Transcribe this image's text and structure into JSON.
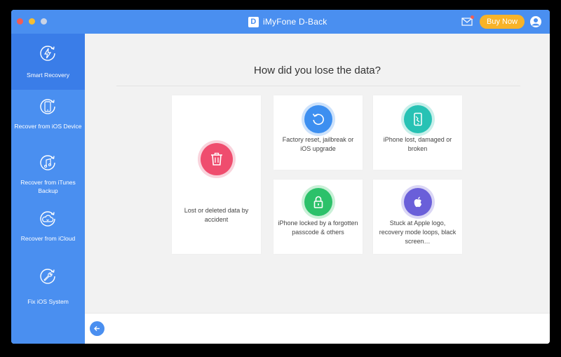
{
  "window": {
    "title": "iMyFone D-Back",
    "logo_letter": "D",
    "buy_label": "Buy Now"
  },
  "sidebar": {
    "items": [
      {
        "label": "Smart Recovery",
        "icon": "smart-recovery-icon",
        "active": true
      },
      {
        "label": "Recover from iOS Device",
        "icon": "ios-device-icon",
        "active": false
      },
      {
        "label": "Recover from iTunes Backup",
        "icon": "itunes-backup-icon",
        "active": false
      },
      {
        "label": "Recover from iCloud",
        "icon": "icloud-icon",
        "active": false
      },
      {
        "label": "Fix iOS System",
        "icon": "fix-system-icon",
        "active": false
      }
    ]
  },
  "main": {
    "heading": "How did you lose the data?",
    "options": [
      {
        "label": "Lost or deleted data by accident",
        "icon": "trash-icon",
        "color": "#ef4d6e"
      },
      {
        "label": "Factory reset, jailbreak or iOS upgrade",
        "icon": "reset-icon",
        "color": "#3d8ff0"
      },
      {
        "label": "iPhone lost, damaged or broken",
        "icon": "broken-phone-icon",
        "color": "#27c2b4"
      },
      {
        "label": "iPhone locked by a forgotten passcode & others",
        "icon": "lock-icon",
        "color": "#2cc16a"
      },
      {
        "label": "Stuck at Apple logo, recovery mode loops, black screen…",
        "icon": "apple-logo-icon",
        "color": "#6a5fd9"
      }
    ]
  },
  "colors": {
    "accent": "#4a8ff0",
    "buy": "#f8b328"
  }
}
